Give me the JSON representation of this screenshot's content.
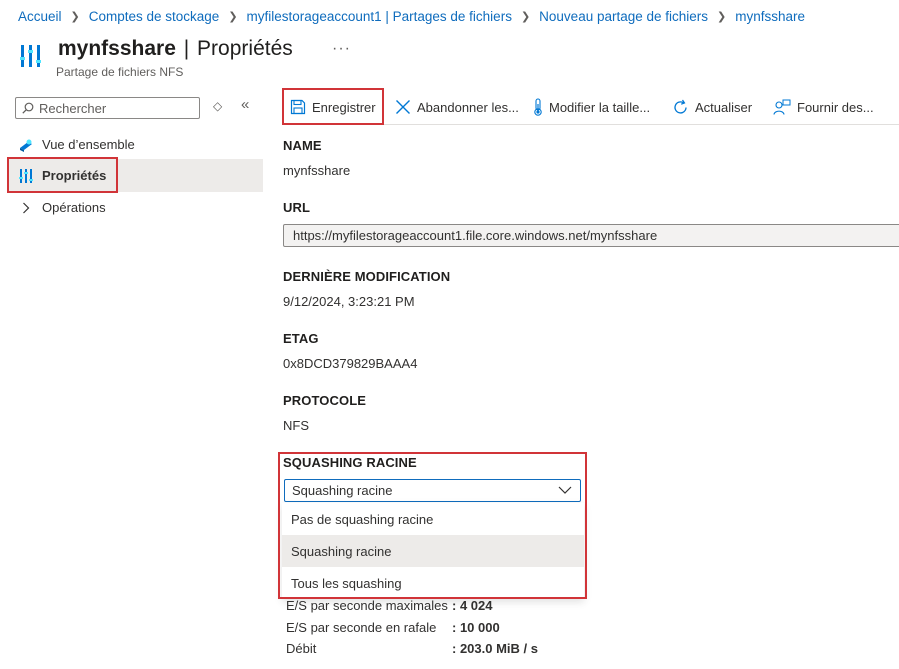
{
  "breadcrumb": [
    {
      "label": "Accueil"
    },
    {
      "label": "Comptes de stockage"
    },
    {
      "label": "myfilestorageaccount1 | Partages de fichiers"
    },
    {
      "label": "Nouveau partage de fichiers"
    },
    {
      "label": "mynfsshare"
    }
  ],
  "header": {
    "title_name": "mynfsshare",
    "title_sep": "|",
    "title_section": "Propriétés",
    "more": "···",
    "subtitle": "Partage de fichiers NFS"
  },
  "sidebar": {
    "search_placeholder": "Rechercher",
    "expand_glyph": "◇",
    "collapse_glyph": "«",
    "items": [
      {
        "label": "Vue d’ensemble",
        "icon": "overview-cloud-icon"
      },
      {
        "label": "Propriétés",
        "icon": "properties-bars-icon",
        "active": true
      },
      {
        "label": "Opérations",
        "icon": "chevron-right-icon"
      }
    ]
  },
  "toolbar": {
    "save": "Enregistrer",
    "discard": "Abandonner les...",
    "resize": "Modifier la taille...",
    "refresh": "Actualiser",
    "feedback": "Fournir des..."
  },
  "properties": {
    "name_label": "NAME",
    "name_value": "mynfsshare",
    "url_label": "URL",
    "url_value": "https://myfilestorageaccount1.file.core.windows.net/mynfsshare",
    "modified_label": "DERNIÈRE MODIFICATION",
    "modified_value": "9/12/2024, 3:23:21 PM",
    "etag_label": "ETAG",
    "etag_value": "0x8DCD379829BAAA4",
    "protocol_label": "PROTOCOLE",
    "protocol_value": "NFS",
    "squash_label": "SQUASHING RACINE",
    "squash_selected": "Squashing racine",
    "squash_options": [
      "Pas de squashing racine",
      "Squashing racine",
      "Tous les squashing"
    ]
  },
  "metrics": [
    {
      "label": "E/S par seconde maximales",
      "value": ": 4 024"
    },
    {
      "label": "E/S par seconde en rafale",
      "value": ": 10 000"
    },
    {
      "label": "Débit",
      "value": ": 203.0 MiB / s"
    }
  ],
  "colors": {
    "link": "#0f6cbd",
    "highlight_box": "#d13438",
    "selected_bg": "#edebe9",
    "icon_blue": "#0078d4"
  }
}
